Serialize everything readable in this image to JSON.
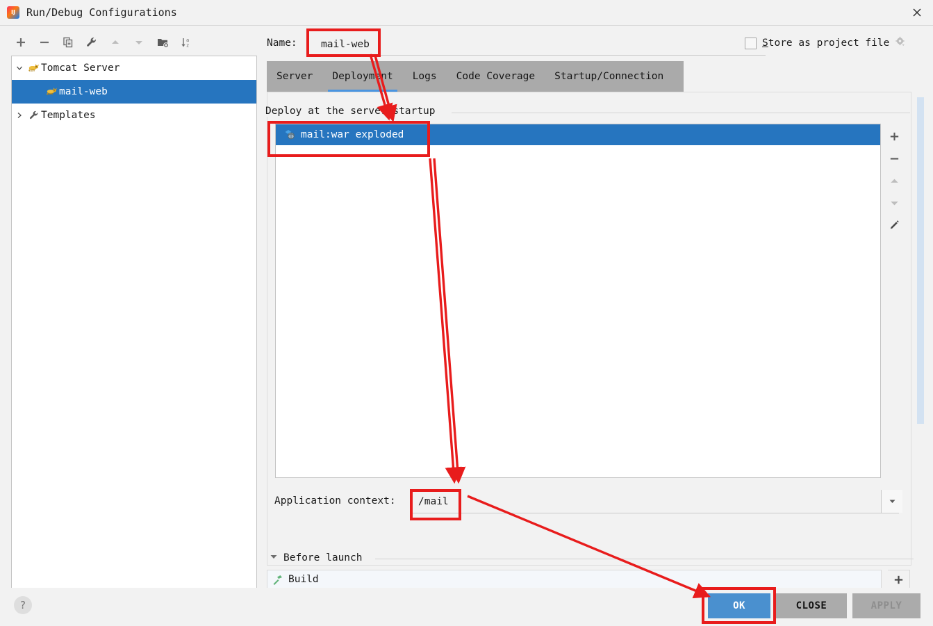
{
  "window": {
    "title": "Run/Debug Configurations",
    "app_icon": "intellij-idea-logo-icon",
    "close_icon": "close-icon"
  },
  "left_toolbar": {
    "buttons": [
      {
        "name": "add-configuration-button",
        "icon": "plus-icon",
        "label": "+"
      },
      {
        "name": "remove-configuration-button",
        "icon": "minus-icon",
        "label": "−"
      },
      {
        "name": "copy-configuration-button",
        "icon": "copy-icon",
        "label": "Copy"
      },
      {
        "name": "edit-templates-button",
        "icon": "wrench-icon",
        "label": "Edit Templates"
      },
      {
        "name": "move-up-button",
        "icon": "arrow-up-icon",
        "label": "Move Up"
      },
      {
        "name": "move-down-button",
        "icon": "arrow-down-icon",
        "label": "Move Down"
      },
      {
        "name": "new-folder-button",
        "icon": "folder-add-icon",
        "label": "New Folder"
      },
      {
        "name": "sort-configurations-button",
        "icon": "sort-alpha-icon",
        "label": "Sort Configurations"
      }
    ]
  },
  "tree": {
    "nodes": [
      {
        "label": "Tomcat Server",
        "icon": "tomcat-icon",
        "arrow": "chevron-down-icon",
        "selected": false,
        "indent": 0
      },
      {
        "label": "mail-web",
        "icon": "tomcat-icon",
        "arrow": "",
        "selected": true,
        "indent": 1
      },
      {
        "label": "Templates",
        "icon": "wrench-icon",
        "arrow": "chevron-right-icon",
        "selected": false,
        "indent": 0
      }
    ]
  },
  "form": {
    "name_label": "Name:",
    "name_value": "mail-web",
    "name_placeholder": "Name",
    "store_as_project_file_label_prefix": "S",
    "store_as_project_file_label_rest": "tore as project file",
    "store_as_project_file_checked": false,
    "store_gear_icon": "gear-icon"
  },
  "tabs": [
    {
      "label": "Server",
      "active": false
    },
    {
      "label": "Deployment",
      "active": true
    },
    {
      "label": "Logs",
      "active": false
    },
    {
      "label": "Code Coverage",
      "active": false
    },
    {
      "label": "Startup/Connection",
      "active": false
    }
  ],
  "deployment": {
    "group_title": "Deploy at the server startup",
    "items": [
      {
        "label": "mail:war exploded",
        "icon": "artifact-icon",
        "selected": true
      }
    ],
    "side_buttons": [
      {
        "name": "add-artifact-button",
        "icon": "plus-icon"
      },
      {
        "name": "remove-artifact-button",
        "icon": "minus-icon"
      },
      {
        "name": "move-artifact-up-button",
        "icon": "arrow-up-icon"
      },
      {
        "name": "move-artifact-down-button",
        "icon": "arrow-down-icon"
      },
      {
        "name": "edit-artifact-button",
        "icon": "pencil-icon"
      }
    ],
    "application_context_label": "Application context:",
    "application_context_value": "/mail",
    "application_context_placeholder": "",
    "application_context_dropdown_icon": "chevron-down-icon"
  },
  "before_launch": {
    "header": "Before launch",
    "collapse_icon": "triangle-down-icon",
    "tasks": [
      {
        "label": "Build",
        "icon": "build-hammer-icon"
      }
    ],
    "add_task_icon": "plus-icon"
  },
  "bottom": {
    "help_icon": "question-mark-icon",
    "ok_label": "OK",
    "close_label": "CLOSE",
    "apply_label": "APPLY",
    "apply_disabled": true
  },
  "colors": {
    "selection_blue": "#2675bf",
    "ok_button_blue": "#4a90cf",
    "annotation_red": "#e81c1c",
    "tab_strip_gray": "#aaaaaa",
    "window_bg": "#f2f2f2",
    "scrollbar_thumb": "#d3e2f2"
  },
  "annotations": {
    "highlight_boxes": [
      {
        "name": "name-field-highlight"
      },
      {
        "name": "deploy-item-highlight"
      },
      {
        "name": "application-context-highlight"
      },
      {
        "name": "ok-button-highlight"
      }
    ],
    "arrows": [
      {
        "name": "arrow-name-to-deployment-tab"
      },
      {
        "name": "arrow-deploy-item-to-context"
      },
      {
        "name": "arrow-context-to-ok"
      }
    ]
  }
}
